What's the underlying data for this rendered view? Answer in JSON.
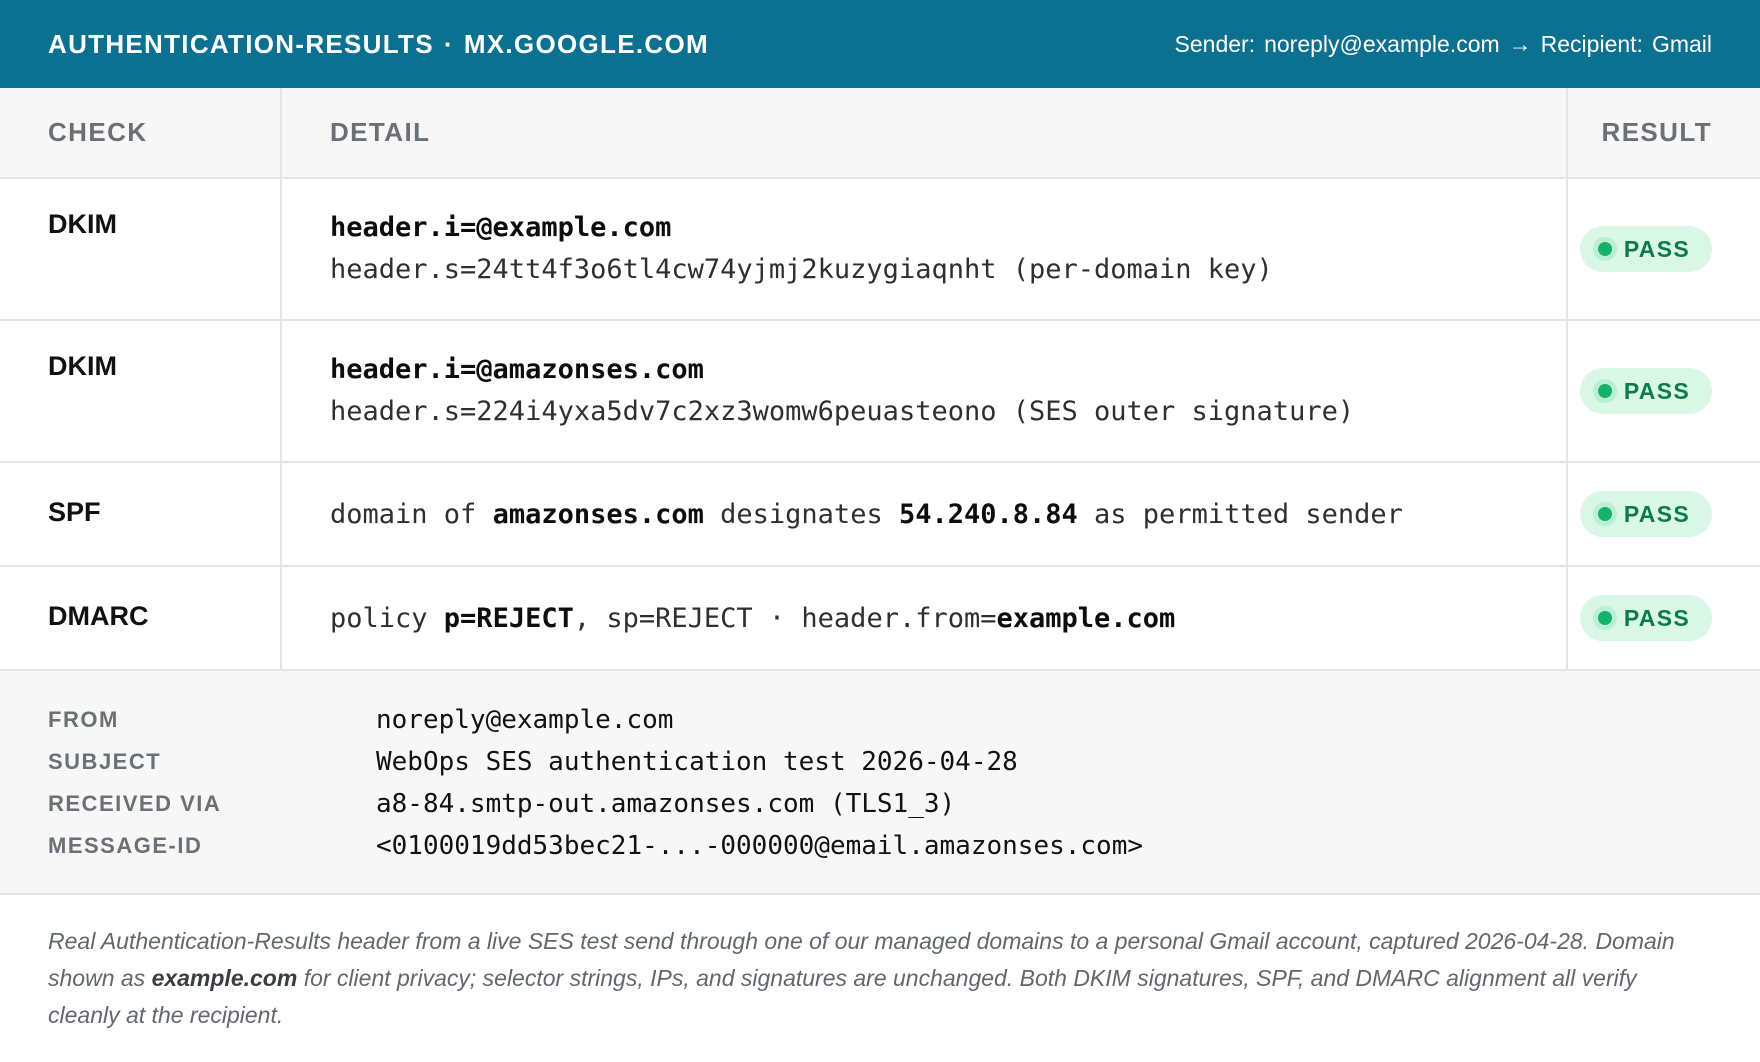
{
  "header": {
    "title": "AUTHENTICATION-RESULTS",
    "separator": "·",
    "server": "MX.GOOGLE.COM",
    "sender_label": "Sender:",
    "sender": "noreply@example.com",
    "arrow": "→",
    "recipient_label": "Recipient:",
    "recipient": "Gmail"
  },
  "table": {
    "columns": {
      "check": "CHECK",
      "detail": "DETAIL",
      "result": "RESULT"
    },
    "rows": [
      {
        "check": "DKIM",
        "line1": "header.i=@example.com",
        "line2": "header.s=24tt4f3o6tl4cw74yjmj2kuzygiaqnht (per-domain key)",
        "result": "PASS"
      },
      {
        "check": "DKIM",
        "line1": "header.i=@amazonses.com",
        "line2": "header.s=224i4yxa5dv7c2xz3womw6peuasteono (SES outer signature)",
        "result": "PASS"
      },
      {
        "check": "SPF",
        "parts": [
          "domain of ",
          "amazonses.com",
          " designates ",
          "54.240.8.84",
          " as permitted sender"
        ],
        "result": "PASS"
      },
      {
        "check": "DMARC",
        "parts": [
          "policy ",
          "p=REJECT",
          ", sp=REJECT · header.from=",
          "example.com"
        ],
        "result": "PASS"
      }
    ]
  },
  "meta": {
    "from_label": "FROM",
    "from": "noreply@example.com",
    "subject_label": "SUBJECT",
    "subject": "WebOps SES authentication test 2026-04-28",
    "received_label": "RECEIVED VIA",
    "received": "a8-84.smtp-out.amazonses.com (TLS1_3)",
    "message_id_label": "MESSAGE-ID",
    "message_id": "<0100019dd53bec21-...-000000@email.amazonses.com>"
  },
  "footnote": {
    "before": "Real Authentication-Results header from a live SES test send through one of our managed domains to a personal Gmail account, captured 2026-04-28. Domain shown as ",
    "emphasis": "example.com",
    "after": " for client privacy; selector strings, IPs, and signatures are unchanged. Both DKIM signatures, SPF, and DMARC alignment all verify cleanly at the recipient."
  },
  "colors": {
    "header_bg": "#0c7090",
    "pass_bg": "#d9f6e7",
    "pass_text": "#0d7a4a",
    "pass_dot": "#16b26a"
  },
  "icons": {
    "status": "status-dot-icon"
  }
}
